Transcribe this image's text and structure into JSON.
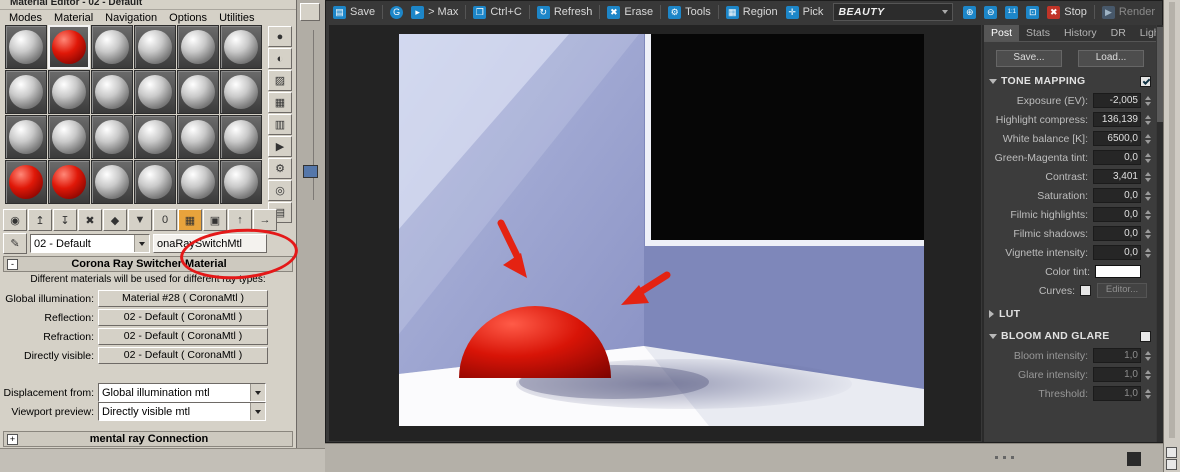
{
  "material_editor": {
    "title": "Material Editor - 02 - Default",
    "menus": [
      "Modes",
      "Material",
      "Navigation",
      "Options",
      "Utilities"
    ],
    "slots": [
      "gray",
      "red",
      "gray",
      "gray",
      "gray",
      "gray",
      "gray",
      "gray",
      "gray",
      "gray",
      "gray",
      "gray",
      "gray",
      "gray",
      "gray",
      "gray",
      "gray",
      "gray",
      "red",
      "red",
      "gray",
      "gray",
      "gray",
      "gray"
    ],
    "active_slot": 1,
    "side_tools": [
      {
        "name": "sample-type-sphere-icon",
        "glyph": "●"
      },
      {
        "name": "backlight-icon",
        "glyph": "◐"
      },
      {
        "name": "background-icon",
        "glyph": "▨"
      },
      {
        "name": "sample-uv-tiling-icon",
        "glyph": "▦"
      },
      {
        "name": "video-color-check-icon",
        "glyph": "▥"
      },
      {
        "name": "make-preview-icon",
        "glyph": "▶"
      },
      {
        "name": "options-icon",
        "glyph": "⚙"
      },
      {
        "name": "select-by-material-icon",
        "glyph": "◎"
      },
      {
        "name": "material-map-navigator-icon",
        "glyph": "▤"
      }
    ],
    "toolbar_tools": [
      {
        "name": "get-material-icon",
        "glyph": "◉"
      },
      {
        "name": "put-to-scene-icon",
        "glyph": "↥"
      },
      {
        "name": "assign-to-selection-icon",
        "glyph": "↧"
      },
      {
        "name": "reset-map-icon",
        "glyph": "✖"
      },
      {
        "name": "make-unique-icon",
        "glyph": "◆"
      },
      {
        "name": "put-to-library-icon",
        "glyph": "▼"
      },
      {
        "name": "material-id-icon",
        "glyph": "0"
      },
      {
        "name": "show-map-in-viewport-icon",
        "glyph": "▦",
        "hl": true
      },
      {
        "name": "show-end-result-icon",
        "glyph": "▣"
      },
      {
        "name": "go-to-parent-icon",
        "glyph": "↑"
      },
      {
        "name": "go-forward-icon",
        "glyph": "→"
      }
    ],
    "eyedropper_glyph": "✎",
    "material_name": "02 - Default",
    "material_type": "onaRaySwitchMtl",
    "rollout_minus": "-",
    "rollout_title": "Corona Ray Switcher Material",
    "description": "Different materials will be used for different ray types:",
    "params": [
      {
        "label": "Global illumination:",
        "value": "Material #28 ( CoronaMtl )"
      },
      {
        "label": "Reflection:",
        "value": "02 - Default ( CoronaMtl )"
      },
      {
        "label": "Refraction:",
        "value": "02 - Default ( CoronaMtl )"
      },
      {
        "label": "Directly visible:",
        "value": "02 - Default ( CoronaMtl )"
      }
    ],
    "combos": [
      {
        "label": "Displacement from:",
        "value": "Global illumination mtl"
      },
      {
        "label": "Viewport preview:",
        "value": "Directly visible mtl"
      }
    ],
    "bottom_rollout": {
      "plus": "+",
      "title": "mental ray Connection"
    }
  },
  "vfb": {
    "toolbar": {
      "save": "Save",
      "gamma": "G",
      "max": "> Max",
      "copy": "Ctrl+C",
      "refresh": "Refresh",
      "erase": "Erase",
      "tools": "Tools",
      "region": "Region",
      "pick": "Pick",
      "channel": "BEAUTY",
      "stop": "Stop",
      "render": "Render"
    },
    "icons": {
      "save": "▤",
      "gamma": "G",
      "max": "▸",
      "copy": "❐",
      "refresh": "↻",
      "erase": "✖",
      "tools": "⚙",
      "region": "▦",
      "pick": "✛",
      "zoom_in": "⊕",
      "zoom_out": "⊖",
      "zoom_actual": "1:1",
      "zoom_fit": "⊡",
      "stop": "✖",
      "render": "▶"
    },
    "tabs": [
      "Post",
      "Stats",
      "History",
      "DR",
      "LightMix"
    ],
    "save_button": "Save...",
    "load_button": "Load...",
    "tone_mapping": {
      "title": "TONE MAPPING",
      "params": [
        {
          "label": "Exposure (EV):",
          "value": "-2,005"
        },
        {
          "label": "Highlight compress:",
          "value": "136,139"
        },
        {
          "label": "White balance [K]:",
          "value": "6500,0"
        },
        {
          "label": "Green-Magenta tint:",
          "value": "0,0"
        },
        {
          "label": "Contrast:",
          "value": "3,401"
        },
        {
          "label": "Saturation:",
          "value": "0,0"
        },
        {
          "label": "Filmic highlights:",
          "value": "0,0"
        },
        {
          "label": "Filmic shadows:",
          "value": "0,0"
        },
        {
          "label": "Vignette intensity:",
          "value": "0,0"
        }
      ],
      "color_tint_label": "Color tint:",
      "curves_label": "Curves:",
      "editor_button": "Editor..."
    },
    "lut_title": "LUT",
    "bloom": {
      "title": "BLOOM AND GLARE",
      "params": [
        {
          "label": "Bloom intensity:",
          "value": "1,0"
        },
        {
          "label": "Glare intensity:",
          "value": "1,0"
        },
        {
          "label": "Threshold:",
          "value": "1,0"
        }
      ]
    }
  },
  "colors": {
    "accent_blue": "#1d86c8",
    "annotation_red": "#e41818",
    "dome_red": "#d01208",
    "tint_swatch": "#ffffff"
  }
}
